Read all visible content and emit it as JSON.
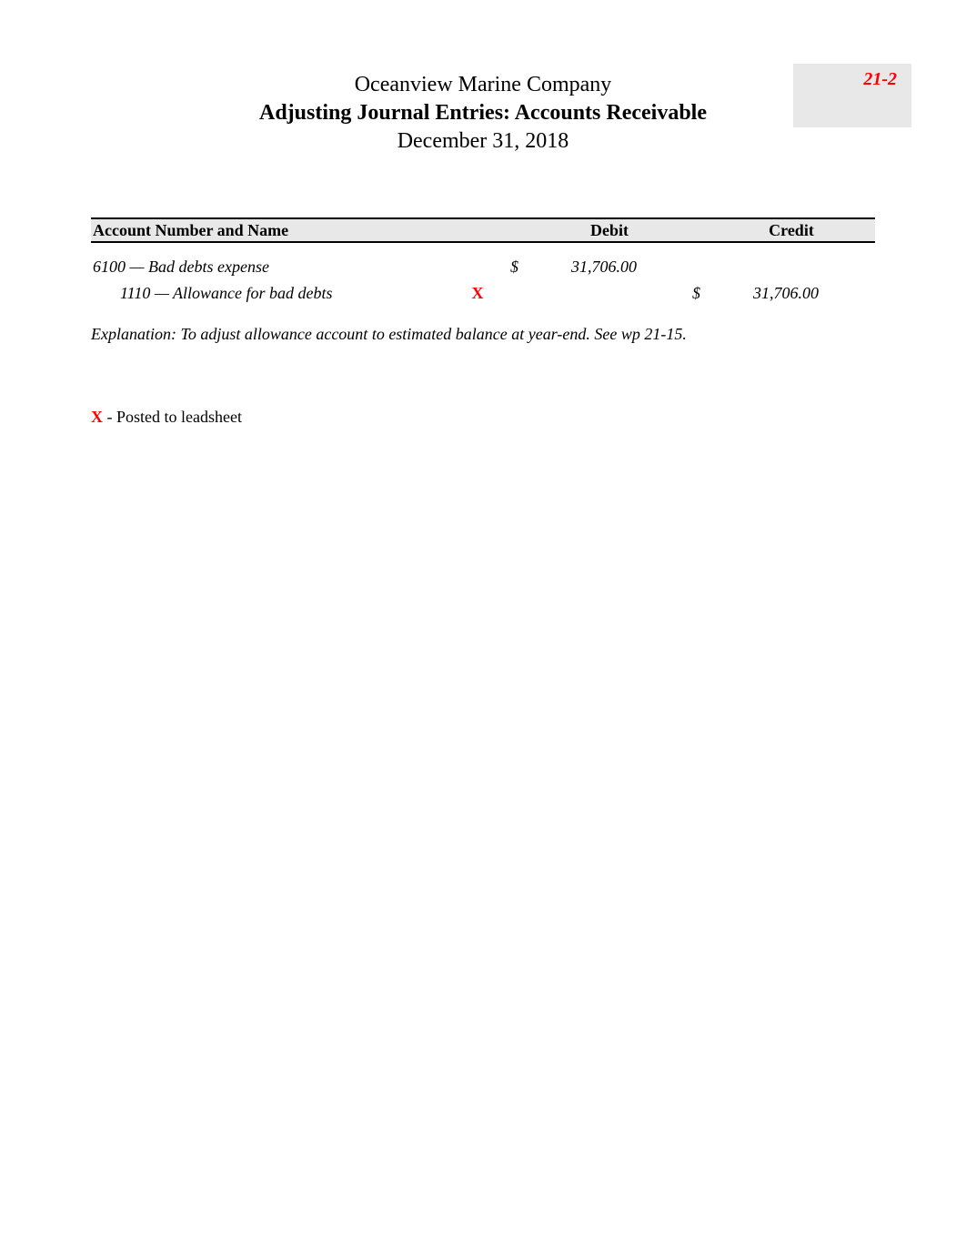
{
  "header": {
    "company": "Oceanview Marine Company",
    "title": "Adjusting Journal Entries: Accounts Receivable",
    "date": "December 31, 2018"
  },
  "page_ref": "21-2",
  "table": {
    "columns": {
      "account": "Account Number and Name",
      "debit": "Debit",
      "credit": "Credit"
    },
    "rows": [
      {
        "account": "6100 — Bad debts expense",
        "tick": "",
        "debit_symbol": "$",
        "debit_amount": "31,706.00",
        "credit_symbol": "",
        "credit_amount": ""
      },
      {
        "account": "1110 — Allowance for bad debts",
        "tick": "X",
        "debit_symbol": "",
        "debit_amount": "",
        "credit_symbol": "$",
        "credit_amount": "31,706.00"
      }
    ]
  },
  "explanation": "Explanation:  To adjust allowance account to estimated balance at year-end. See wp 21-15.",
  "legend": {
    "mark": "X",
    "text": " - Posted to leadsheet"
  }
}
